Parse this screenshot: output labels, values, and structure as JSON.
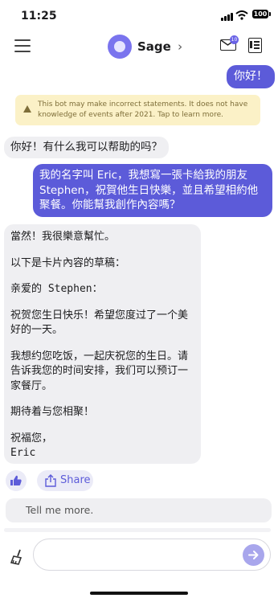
{
  "status_bar": {
    "time": "11:25",
    "battery": "100"
  },
  "header": {
    "bot_name": "Sage",
    "chevron": "›",
    "notification_count": "10"
  },
  "messages": {
    "user_1": "你好！",
    "warning": "This bot may make incorrect statements. It does not have knowledge of events after 2021. Tap to learn more.",
    "bot_1": "你好！有什么我可以帮助的吗？",
    "user_2": "我的名字叫 Eric，我想寫一張卡給我的朋友 Stephen，祝賀他生日快樂，並且希望相約他聚餐。你能幫我創作內容嗎？",
    "bot_2": {
      "line_1": "當然！我很樂意幫忙。",
      "line_2": "以下是卡片內容的草稿：",
      "line_3": "亲爱的 Stephen：",
      "line_4": "祝贺您生日快乐！希望您度过了一个美好的一天。",
      "line_5": "我想约您吃饭，一起庆祝您的生日。请告诉我您的时间安排，我们可以预订一家餐厅。",
      "line_6": "期待着与您相聚！",
      "line_7": "祝福您，",
      "line_8": "Eric"
    }
  },
  "actions": {
    "share_label": "Share",
    "suggestion": "Tell me more."
  },
  "composer": {
    "placeholder": ""
  },
  "icons": {
    "menu": "hamburger-icon",
    "avatar": "bot-avatar",
    "mail": "mail-icon",
    "doc": "document-icon",
    "like": "thumbs-up-icon",
    "share": "share-icon",
    "clear": "broom-icon",
    "send": "arrow-right-icon",
    "warning": "warning-triangle-icon"
  },
  "colors": {
    "accent": "#5c5bd9",
    "bot_bubble": "#efeff2",
    "warning_bg": "#fbf1c7"
  }
}
